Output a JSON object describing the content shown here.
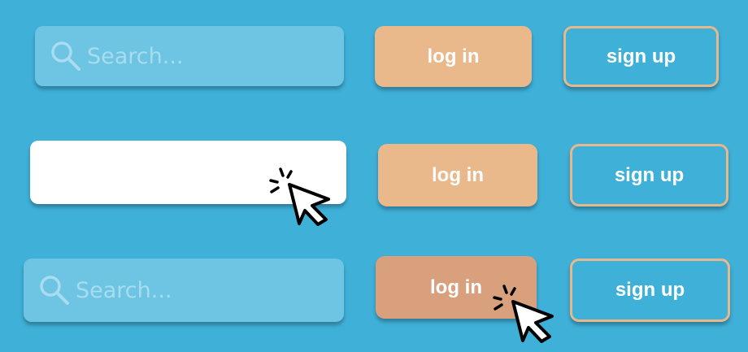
{
  "colors": {
    "background": "#3fb0d8",
    "search_bg": "#6dc4e3",
    "placeholder_text": "#a8dcef",
    "login_bg": "#e9b98c",
    "login_pressed_bg": "#d8a07d",
    "signup_border": "#e6b88c"
  },
  "rows": [
    {
      "state": "default",
      "search": {
        "icon": "search-icon",
        "placeholder": "Search..."
      },
      "login_label": "log in",
      "signup_label": "sign up"
    },
    {
      "state": "search-focused",
      "search": {
        "icon": "",
        "placeholder": ""
      },
      "login_label": "log in",
      "signup_label": "sign up",
      "cursor": "click-cursor-icon"
    },
    {
      "state": "login-pressed",
      "search": {
        "icon": "search-icon",
        "placeholder": "Search..."
      },
      "login_label": "log in",
      "signup_label": "sign up",
      "cursor": "click-cursor-icon"
    }
  ]
}
